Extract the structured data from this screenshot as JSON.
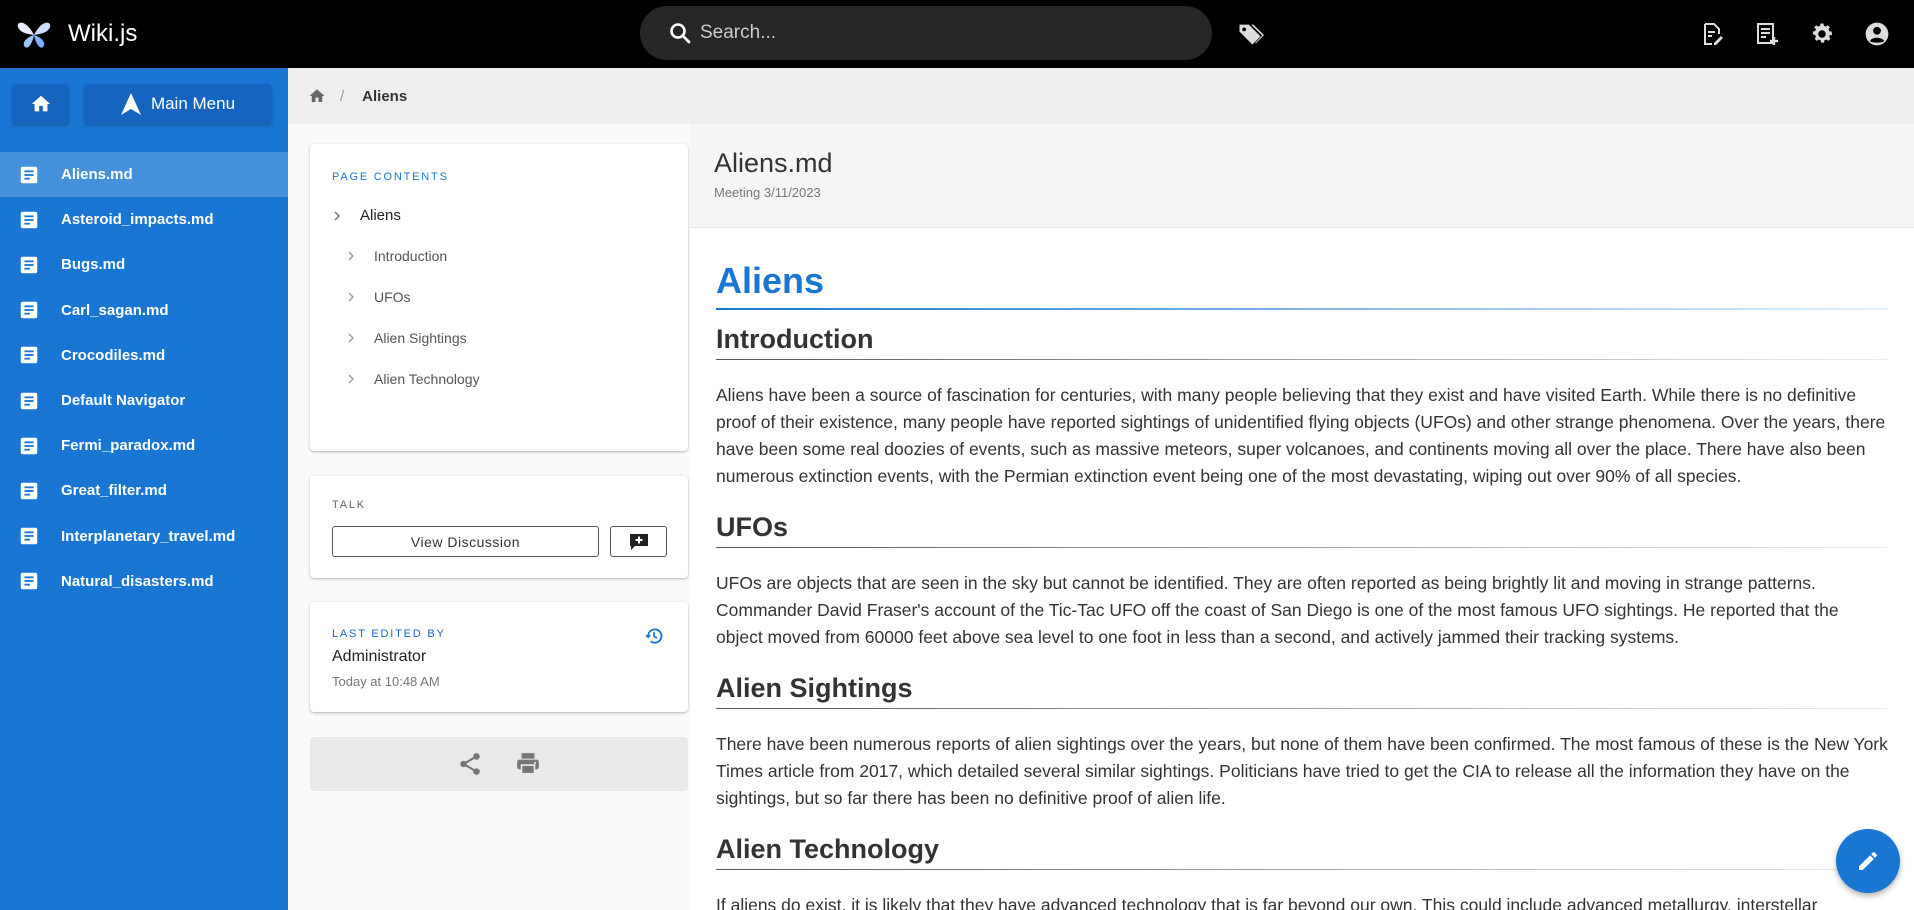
{
  "app": {
    "name": "Wiki.js"
  },
  "search": {
    "placeholder": "Search..."
  },
  "topbar": {
    "icons": [
      "tags-icon",
      "new-page-icon",
      "page-actions-icon",
      "admin-gear-icon",
      "account-icon"
    ]
  },
  "sidebar": {
    "main_menu_label": "Main Menu",
    "items": [
      {
        "label": "Aliens.md",
        "active": true
      },
      {
        "label": "Asteroid_impacts.md"
      },
      {
        "label": "Bugs.md"
      },
      {
        "label": "Carl_sagan.md"
      },
      {
        "label": "Crocodiles.md"
      },
      {
        "label": "Default Navigator"
      },
      {
        "label": "Fermi_paradox.md"
      },
      {
        "label": "Great_filter.md"
      },
      {
        "label": "Interplanetary_travel.md"
      },
      {
        "label": "Natural_disasters.md"
      }
    ]
  },
  "breadcrumb": {
    "current": "Aliens"
  },
  "toc": {
    "label": "PAGE CONTENTS",
    "main": "Aliens",
    "items": [
      "Introduction",
      "UFOs",
      "Alien Sightings",
      "Alien Technology"
    ]
  },
  "talk": {
    "label": "TALK",
    "view_discussion": "View Discussion"
  },
  "last_edited": {
    "label": "LAST EDITED BY",
    "name": "Administrator",
    "time": "Today at 10:48 AM"
  },
  "page": {
    "title": "Aliens.md",
    "description": "Meeting 3/11/2023",
    "h1": "Aliens",
    "sections": [
      {
        "heading": "Introduction",
        "text": "Aliens have been a source of fascination for centuries, with many people believing that they exist and have visited Earth. While there is no definitive proof of their existence, many people have reported sightings of unidentified flying objects (UFOs) and other strange phenomena. Over the years, there have been some real doozies of events, such as massive meteors, super volcanoes, and continents moving all over the place. There have also been numerous extinction events, with the Permian extinction event being one of the most devastating, wiping out over 90% of all species."
      },
      {
        "heading": "UFOs",
        "text": "UFOs are objects that are seen in the sky but cannot be identified. They are often reported as being brightly lit and moving in strange patterns. Commander David Fraser's account of the Tic-Tac UFO off the coast of San Diego is one of the most famous UFO sightings. He reported that the object moved from 60000 feet above sea level to one foot in less than a second, and actively jammed their tracking systems."
      },
      {
        "heading": "Alien Sightings",
        "text": "There have been numerous reports of alien sightings over the years, but none of them have been confirmed. The most famous of these is the New York Times article from 2017, which detailed several similar sightings. Politicians have tried to get the CIA to release all the information they have on the sightings, but so far there has been no definitive proof of alien life."
      },
      {
        "heading": "Alien Technology",
        "text": "If aliens do exist, it is likely that they have advanced technology that is far beyond our own. This could include advanced metallurgy, interstellar"
      }
    ]
  },
  "colors": {
    "primary": "#1976d2",
    "topbar": "#000000",
    "sidebar_active": "#4691dc"
  }
}
